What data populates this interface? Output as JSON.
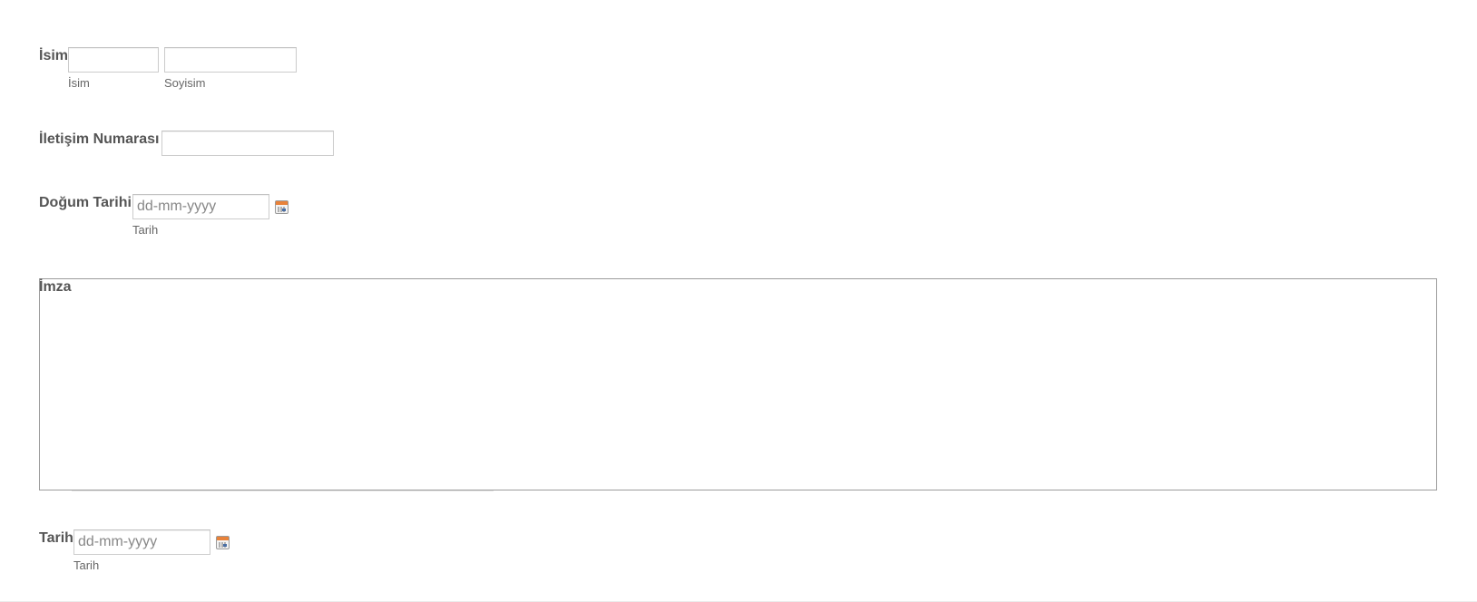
{
  "form": {
    "name": {
      "label": "İsim",
      "first": {
        "value": "",
        "placeholder": "",
        "sublabel": "İsim"
      },
      "last": {
        "value": "",
        "placeholder": "",
        "sublabel": "Soyisim"
      }
    },
    "phone": {
      "label": "İletişim Numarası",
      "value": "",
      "placeholder": ""
    },
    "birth_date": {
      "label": "Doğum Tarihi",
      "value": "",
      "placeholder": "dd-mm-yyyy",
      "sublabel": "Tarih",
      "icon": "calendar-icon"
    },
    "signature": {
      "label": "İmza"
    },
    "date": {
      "label": "Tarih",
      "value": "",
      "placeholder": "dd-mm-yyyy",
      "sublabel": "Tarih",
      "icon": "calendar-icon"
    }
  },
  "colors": {
    "label": "#555555",
    "input_border": "#cccccc",
    "calendar_accent": "#e8823a"
  }
}
